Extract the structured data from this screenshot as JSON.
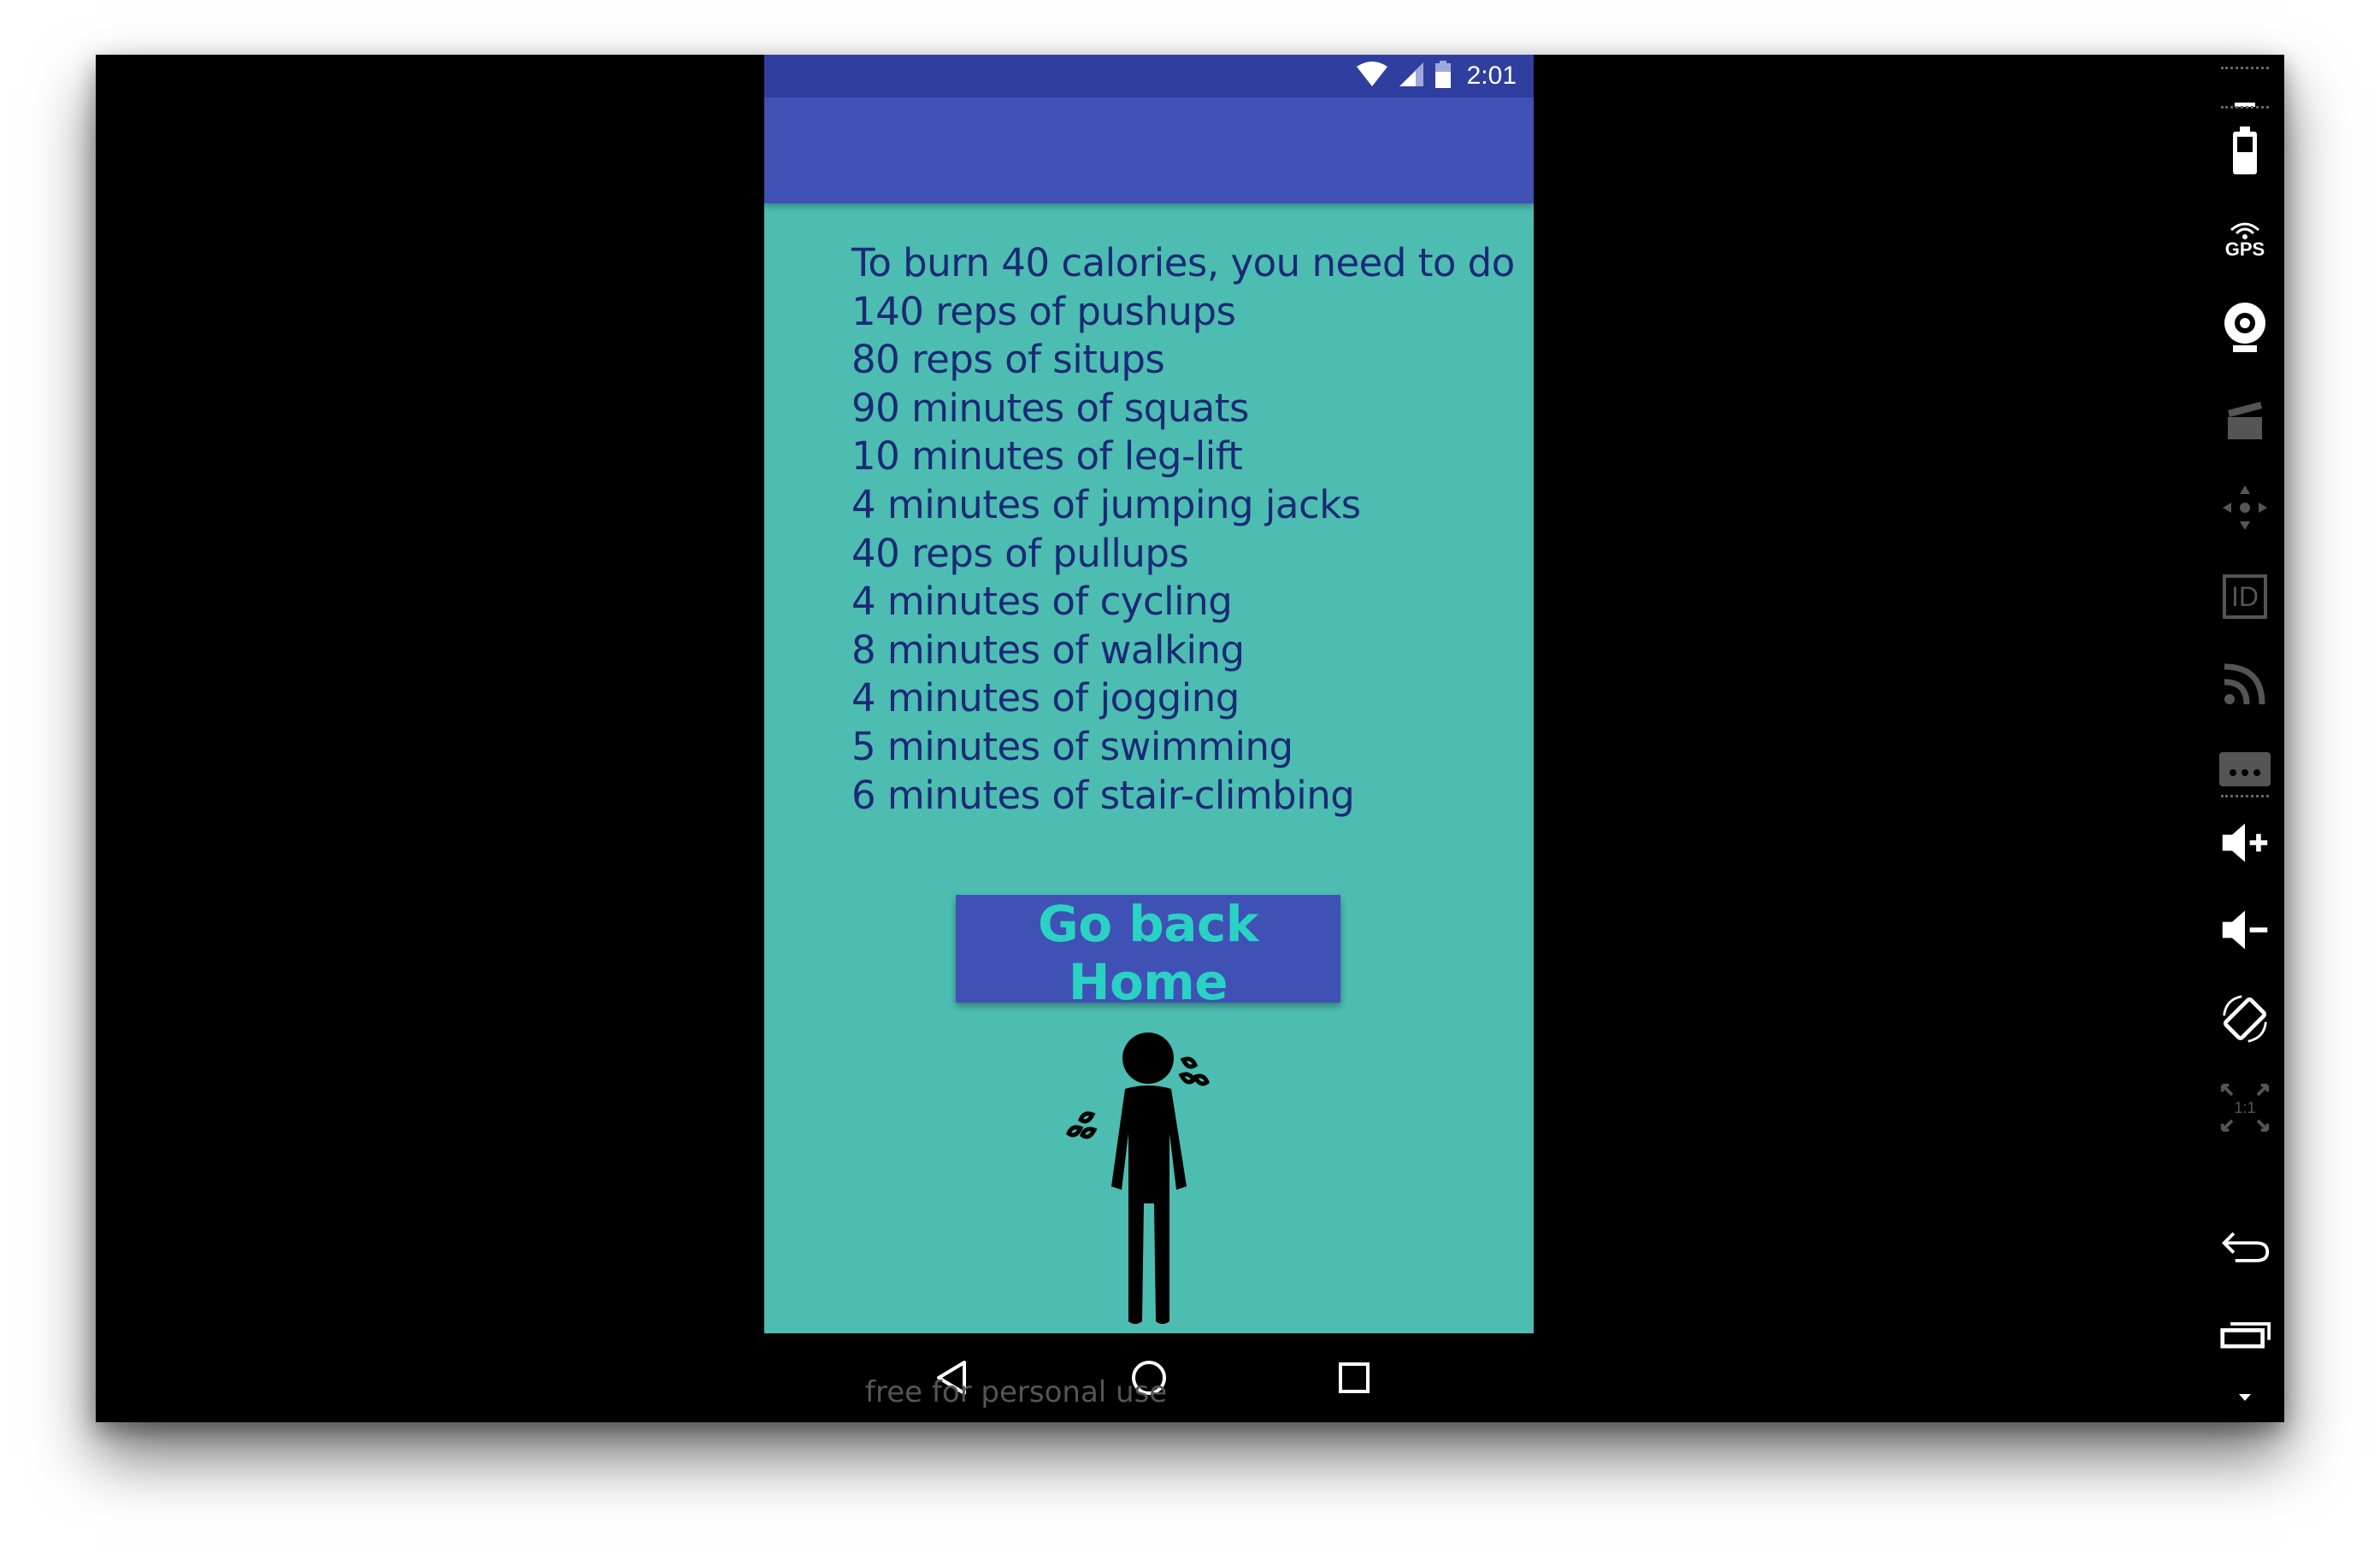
{
  "status_bar": {
    "time": "2:01"
  },
  "result": {
    "lines": [
      "To burn 40 calories, you need to do",
      "140 reps of pushups",
      "80 reps of situps",
      "90 minutes of squats",
      "10 minutes of leg-lift",
      "4 minutes of jumping jacks",
      "40 reps of pullups",
      "4 minutes of cycling",
      "8 minutes of walking",
      "4 minutes of jogging",
      "5 minutes of swimming",
      "6 minutes of stair-climbing"
    ]
  },
  "home_button": {
    "label": "Go back Home"
  },
  "watermark": "free for personal use",
  "toolbar": {
    "gps_label": "GPS",
    "id_label": "ID",
    "zoom_label": "1:1"
  },
  "colors": {
    "status_bar": "#303f9f",
    "app_bar": "#3f51b5",
    "content_bg": "#4dbdb2",
    "text": "#1a2a75",
    "button_bg": "#3f51b5",
    "button_text": "#2ad2c4"
  },
  "icons": {
    "status": [
      "wifi-icon",
      "signal-icon",
      "battery-icon"
    ],
    "nav": [
      "back-icon",
      "home-icon",
      "recents-icon"
    ],
    "toolbar": [
      "minimize-icon",
      "battery-icon",
      "gps-icon",
      "camera-icon",
      "clapperboard-icon",
      "dpad-icon",
      "id-icon",
      "rss-icon",
      "more-icon",
      "volume-up-icon",
      "volume-down-icon",
      "rotate-icon",
      "zoom-fit-icon",
      "back-arrow-icon",
      "recent-apps-icon",
      "expand-icon"
    ]
  }
}
